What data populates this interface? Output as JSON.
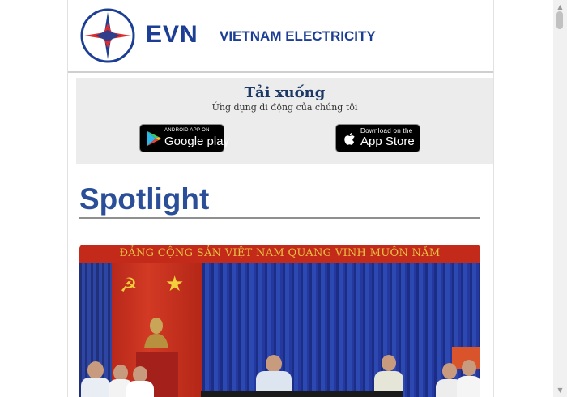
{
  "header": {
    "logo_text": "EVN",
    "logo_subtitle": "VIETNAM ELECTRICITY",
    "brand_color": "#1c3f95",
    "logo_accent": "#e02b2b"
  },
  "download": {
    "title": "Tải xuống",
    "subtitle": "Ứng dụng di động của chúng tôi",
    "google_play": {
      "small": "ANDROID APP ON",
      "big": "Google play",
      "icon": "google-play-icon"
    },
    "app_store": {
      "small": "Download on the",
      "big": "App Store",
      "icon": "apple-icon"
    }
  },
  "spotlight": {
    "title": "Spotlight",
    "title_color": "#2a4e97",
    "photo": {
      "banner_text": "ĐẢNG CỘNG SẢN VIỆT NAM QUANG VINH MUÔN NĂM"
    }
  },
  "scrollbar": {
    "up_icon": "scroll-up-arrow",
    "down_icon": "scroll-down-arrow"
  }
}
